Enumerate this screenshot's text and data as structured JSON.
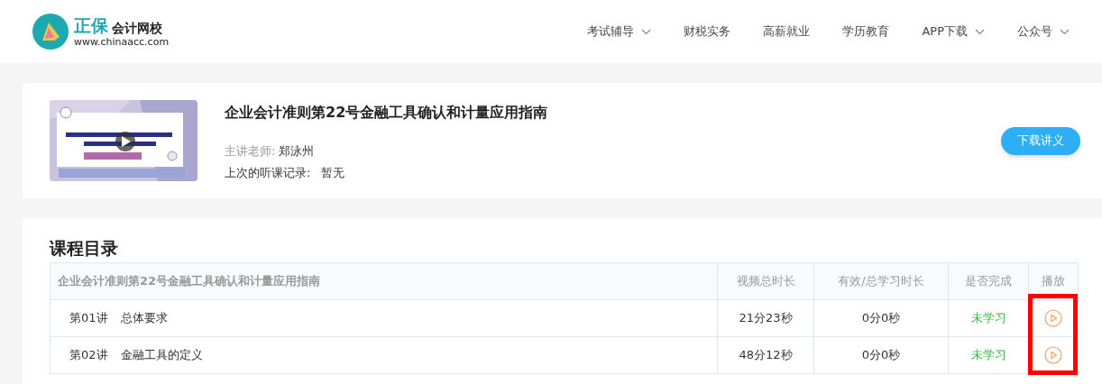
{
  "logo": {
    "name": "正保",
    "sub": "会计网校",
    "url": "www.chinaacc.com"
  },
  "nav": [
    {
      "label": "考试辅导",
      "dropdown": true
    },
    {
      "label": "财税实务",
      "dropdown": false
    },
    {
      "label": "高薪就业",
      "dropdown": false
    },
    {
      "label": "学历教育",
      "dropdown": false
    },
    {
      "label": "APP下载",
      "dropdown": true
    },
    {
      "label": "公众号",
      "dropdown": true
    }
  ],
  "course": {
    "title": "企业会计准则第22号金融工具确认和计量应用指南",
    "teacher_label": "主讲老师:",
    "teacher": "郑泳州",
    "history_label": "上次的听课记录:",
    "history": "暂无",
    "download_button": "下载讲义"
  },
  "catalog": {
    "title": "课程目录",
    "columns": [
      "企业会计准则第22号金融工具确认和计量应用指南",
      "视频总时长",
      "有效/总学习时长",
      "是否完成",
      "播放"
    ],
    "rows": [
      {
        "number": "第01讲",
        "name": "总体要求",
        "duration": "21分23秒",
        "studied": "0分0秒",
        "status": "未学习",
        "completed": false
      },
      {
        "number": "第02讲",
        "name": "金融工具的定义",
        "duration": "48分12秒",
        "studied": "0分0秒",
        "status": "未学习",
        "completed": false
      }
    ],
    "highlight_play_column": true
  }
}
